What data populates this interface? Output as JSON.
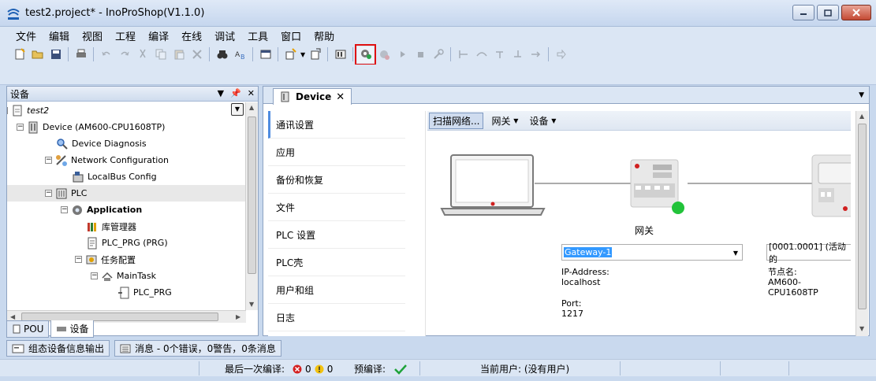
{
  "window": {
    "title": "test2.project* - InoProShop(V1.1.0)",
    "app_icon_text": "INOVANCE"
  },
  "menu": [
    "文件",
    "编辑",
    "视图",
    "工程",
    "编译",
    "在线",
    "调试",
    "工具",
    "窗口",
    "帮助"
  ],
  "toolbar_icons": [
    "new-project",
    "open",
    "save",
    "print",
    "undo",
    "redo",
    "cut",
    "copy",
    "paste",
    "delete",
    "find",
    "replace",
    "bookmark",
    "add-device",
    "export",
    "build",
    "login",
    "logout",
    "run",
    "stop",
    "reset",
    "breakpoint",
    "step-over",
    "step-into",
    "step-out",
    "run-to-cursor",
    "next-statement"
  ],
  "left_panel": {
    "title": "设备",
    "tree": [
      {
        "label": "test2",
        "level": 0,
        "icon": "project-icon",
        "expander": "-",
        "italic": true
      },
      {
        "label": "Device (AM600-CPU1608TP)",
        "level": 1,
        "icon": "device-icon",
        "expander": "-"
      },
      {
        "label": "Device Diagnosis",
        "level": 2,
        "icon": "diagnosis-icon"
      },
      {
        "label": "Network Configuration",
        "level": 2,
        "icon": "network-config-icon",
        "expander": "-"
      },
      {
        "label": "LocalBus Config",
        "level": 3,
        "icon": "localbus-icon"
      },
      {
        "label": "PLC",
        "level": 2,
        "icon": "plc-icon",
        "expander": "-",
        "selected": true
      },
      {
        "label": "Application",
        "level": 3,
        "icon": "application-gear-icon",
        "expander": "-",
        "bold": true
      },
      {
        "label": "库管理器",
        "level": 4,
        "icon": "library-icon"
      },
      {
        "label": "PLC_PRG (PRG)",
        "level": 4,
        "icon": "pou-icon"
      },
      {
        "label": "任务配置",
        "level": 4,
        "icon": "task-config-icon",
        "expander": "-"
      },
      {
        "label": "MainTask",
        "level": 5,
        "icon": "task-icon",
        "expander": "-"
      },
      {
        "label": "PLC_PRG",
        "level": 6,
        "icon": "pou-call-icon"
      }
    ],
    "bottom_tabs": [
      "POU",
      "设备"
    ]
  },
  "editor": {
    "tab_label": "Device",
    "nav_items": [
      "通讯设置",
      "应用",
      "备份和恢复",
      "文件",
      "PLC 设置",
      "PLC壳",
      "用户和组",
      "日志"
    ],
    "subtoolbar": {
      "scan": "扫描网络...",
      "gateway": "网关",
      "device": "设备"
    },
    "gateway_label": "网关",
    "gateway_combo": "Gateway-1",
    "gateway_info": {
      "ip_label": "IP-Address:",
      "ip_value": "localhost",
      "port_label": "Port:",
      "port_value": "1217"
    },
    "device_combo": "[0001.0001] (活动的",
    "device_info": {
      "node_label": "节点名:",
      "node_value": "AM600-CPU1608TP"
    }
  },
  "message_tabs": {
    "device_info_output": "组态设备信息输出",
    "messages": "消息 - 0个错误，0警告，0条消息"
  },
  "statusbar": {
    "last_build_label": "最后一次编译:",
    "errors": "0",
    "warnings": "0",
    "precompile_label": "预编译:",
    "current_user": "当前用户: (没有用户)"
  },
  "colors": {
    "accent": "#4f8ce0",
    "highlight_outline": "#e01010",
    "status_ok": "#22c33a"
  }
}
